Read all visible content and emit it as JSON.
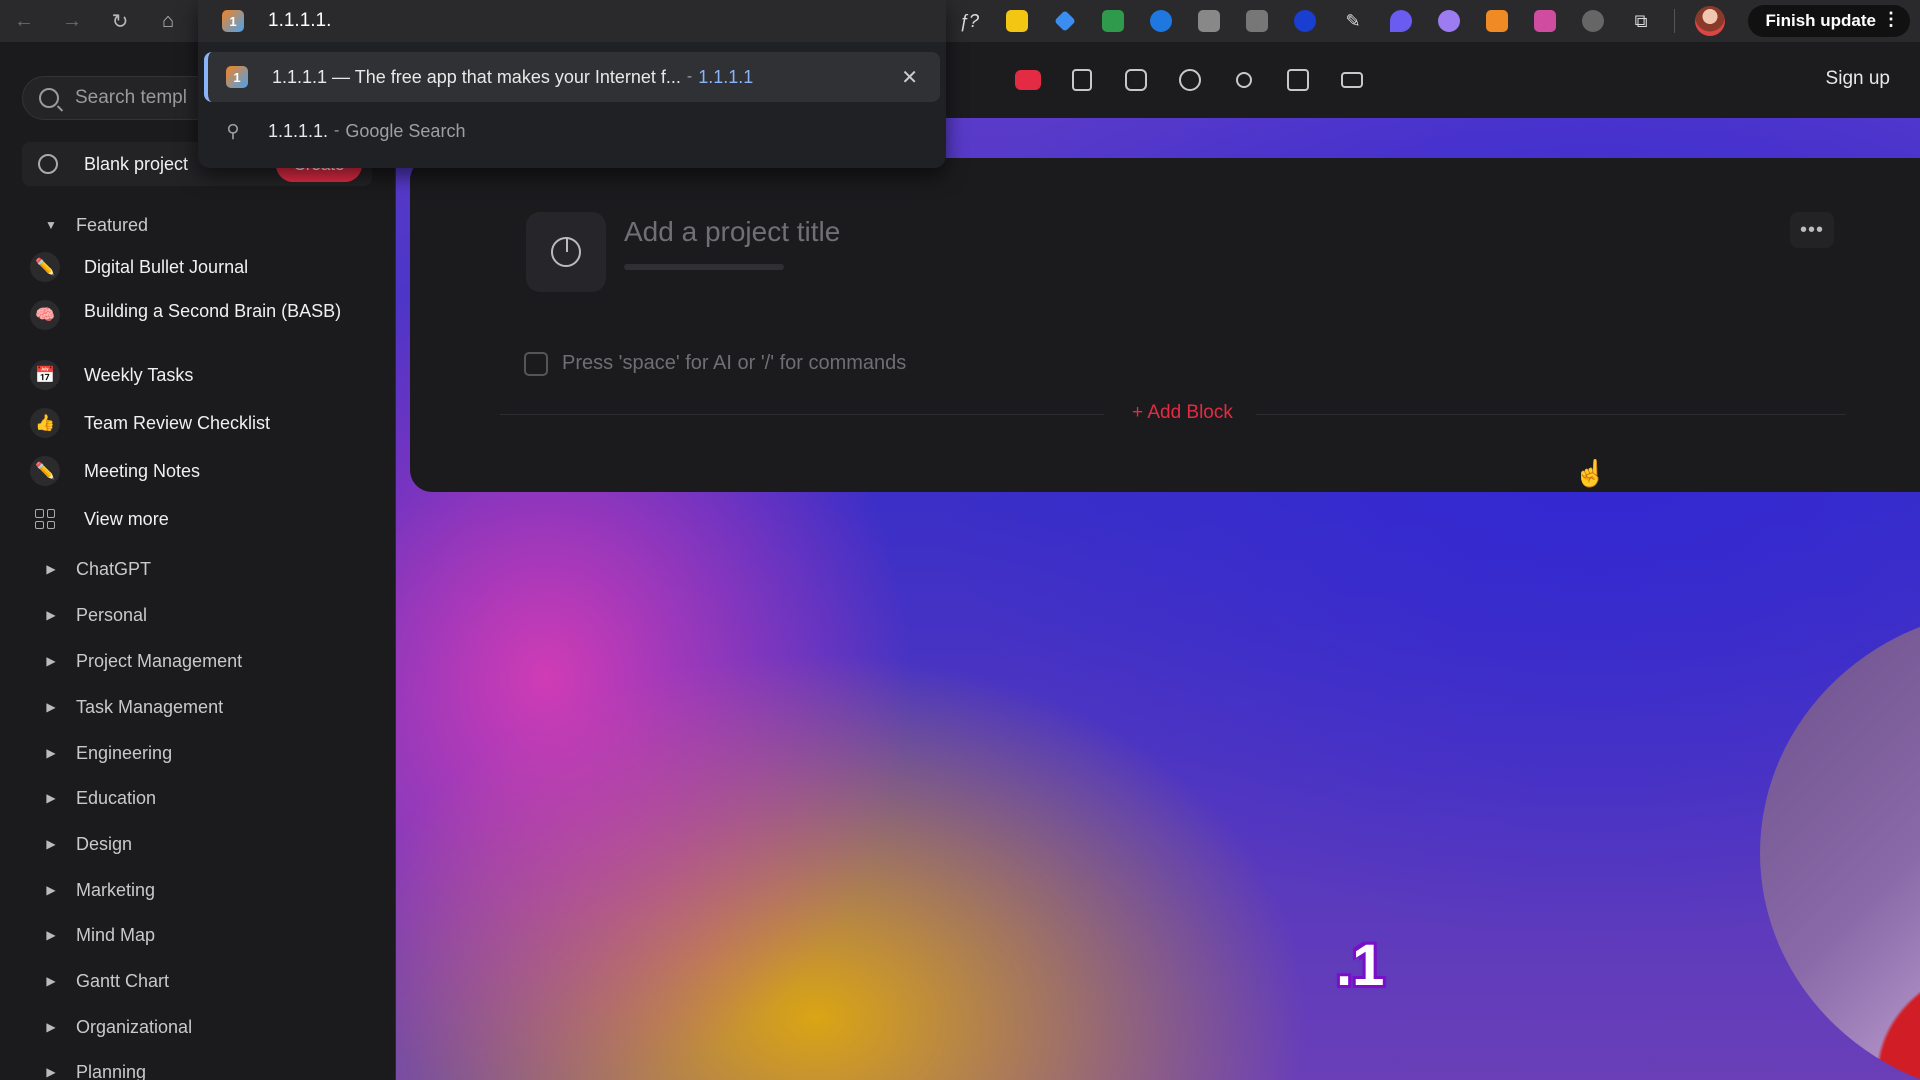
{
  "browser": {
    "omnibox_text": "1.1.1.1.",
    "suggestion_top": {
      "title": "1.1.1.1 — The free app that makes your Internet f...",
      "separator": "-",
      "url": "1.1.1.1"
    },
    "suggestion_search": {
      "query": "1.1.1.1.",
      "separator": "-",
      "engine": "Google Search"
    },
    "close_glyph": "✕",
    "finish_update_label": "Finish update"
  },
  "sidebar": {
    "search_placeholder": "Search templ",
    "blank_project_label": "Blank project",
    "create_label": "Create",
    "featured_label": "Featured",
    "featured_items": [
      {
        "label": "Digital Bullet Journal",
        "icon": "✏️"
      },
      {
        "label": "Building a Second Brain (BASB)",
        "icon": "🧠"
      },
      {
        "label": "Weekly Tasks",
        "icon": "📅"
      },
      {
        "label": "Team Review Checklist",
        "icon": "👍"
      },
      {
        "label": "Meeting Notes",
        "icon": "✏️"
      }
    ],
    "view_more_label": "View more",
    "categories": [
      "ChatGPT",
      "Personal",
      "Project Management",
      "Task Management",
      "Engineering",
      "Education",
      "Design",
      "Marketing",
      "Mind Map",
      "Gantt Chart",
      "Organizational",
      "Planning"
    ]
  },
  "toolbar": {
    "sign_up_label": "Sign up"
  },
  "editor": {
    "title_placeholder": "Add a project title",
    "command_hint": "Press 'space' for AI or '/' for commands",
    "add_block_label": "+ Add Block",
    "more_glyph": "•••"
  },
  "overlay": {
    "caption": ".1"
  },
  "colors": {
    "accent": "#e32b44",
    "link": "#8ab4f8"
  }
}
